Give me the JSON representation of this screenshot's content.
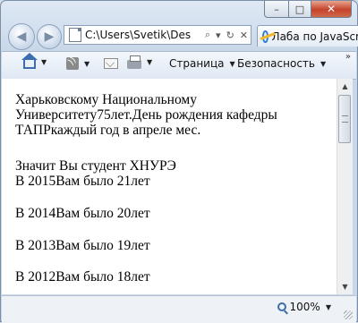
{
  "window": {
    "controls": {
      "minimize": "–",
      "maximize": "□",
      "close": "✕"
    }
  },
  "address": {
    "url": "C:\\Users\\Svetik\\Des",
    "icons": [
      "search-icon",
      "refresh-icon",
      "stop-icon"
    ]
  },
  "tab": {
    "title": "Лаба по JavaScr"
  },
  "command_bar": {
    "page_label": "Страница",
    "safety_label": "Безопасность",
    "icons": [
      "home-icon",
      "rss-icon",
      "mail-icon",
      "print-icon"
    ]
  },
  "content": {
    "paragraphs": [
      "Харьковскому Национальному Университету75лет.День рождения кафедры ТАПРкаждый год в апреле мес.",
      "Значит Вы студент ХНУРЭ",
      "В 2015Вам было 21лет",
      "В 2014Вам было 20лет",
      "В 2013Вам было 19лет",
      "В 2012Вам было 18лет"
    ]
  },
  "status": {
    "zoom": "100%"
  }
}
